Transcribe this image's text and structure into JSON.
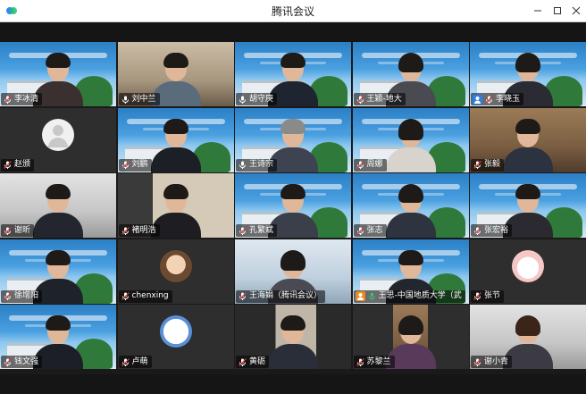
{
  "window": {
    "title": "腾讯会议"
  },
  "colors": {
    "host_badge_blue": "#2e7de0",
    "host_badge_orange": "#f08a1c",
    "mic_active_green": "#3fc06b"
  },
  "participants": [
    {
      "name": "李冰清"
    },
    {
      "name": "刘中兰"
    },
    {
      "name": "胡守庚"
    },
    {
      "name": "王颖-地大"
    },
    {
      "name": "李晓玉"
    },
    {
      "name": "赵颁"
    },
    {
      "name": "刘鹏"
    },
    {
      "name": "王诗宗"
    },
    {
      "name": "周娜"
    },
    {
      "name": "张毅"
    },
    {
      "name": "谢昕"
    },
    {
      "name": "褚明浩"
    },
    {
      "name": "孔繁斌"
    },
    {
      "name": "张志"
    },
    {
      "name": "张宏裕"
    },
    {
      "name": "徐增阳"
    },
    {
      "name": "chenxing"
    },
    {
      "name": "王海娟（腾讯会议）"
    },
    {
      "name": "王思-中国地质大学（武"
    },
    {
      "name": "张节"
    },
    {
      "name": "钱文强"
    },
    {
      "name": "卢萌"
    },
    {
      "name": "黄砺"
    },
    {
      "name": "苏黎兰"
    },
    {
      "name": "谢小青"
    }
  ]
}
